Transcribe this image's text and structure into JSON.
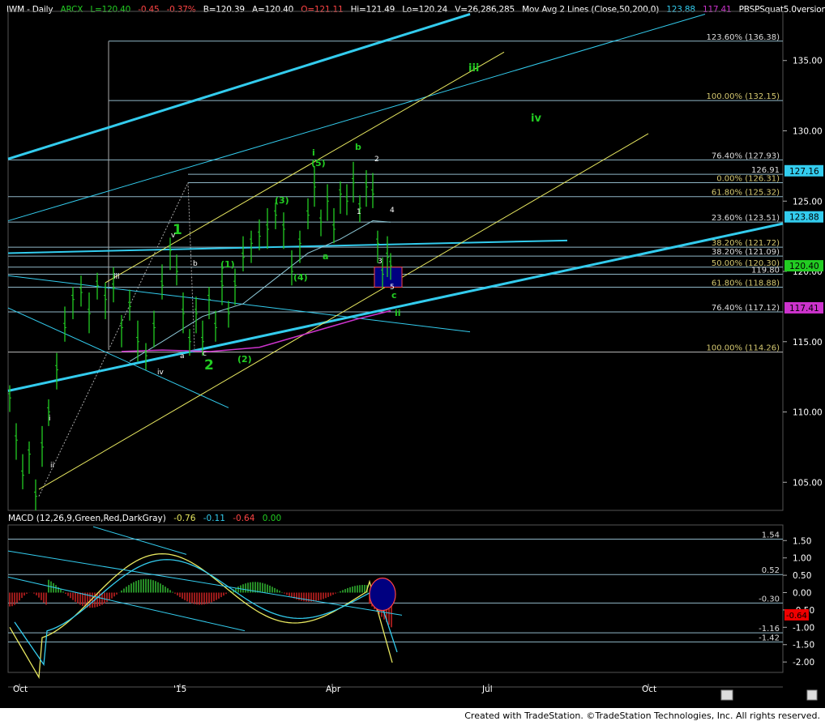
{
  "header": {
    "symbol": "IWM - Daily",
    "exchange": "ARCX",
    "last": "L=120.40",
    "chg": "-0.45",
    "pct": "-0.37%",
    "bid": "B=120.39",
    "ask": "A=120.40",
    "open": "O=121.11",
    "hi": "Hi=121.49",
    "lo": "Lo=120.24",
    "vol": "V=26,286,285",
    "ma_label": "Mov Avg 2 Lines (Close,50,200,0)",
    "ma1": "123.88",
    "ma2": "117.41",
    "indicator": "PBSPSquat5.0version (50,F..."
  },
  "macd_header": {
    "label": "MACD (12,26,9,Green,Red,DarkGray)",
    "v1": "-0.76",
    "v2": "-0.11",
    "v3": "-0.64",
    "v4": "0.00"
  },
  "footer": "Created with TradeStation. ©TradeStation Technologies, Inc. All rights reserved.",
  "colors": {
    "background": "#000000",
    "price_bars": "#22cc22",
    "channel": "#33ccee",
    "fib": "#d4c870",
    "yellow": "#e8e860",
    "magenta": "#cc33cc",
    "up_hist": "#33bb33",
    "down_hist": "#cc2222",
    "wave_label": "#22cc22"
  },
  "chart_data": [
    {
      "type": "ohlc",
      "title": "IWM - Daily",
      "x_tick_labels": [
        "Oct",
        "'15",
        "Apr",
        "Jul",
        "Oct"
      ],
      "y_tick_labels": [
        "135.00",
        "130.00",
        "125.00",
        "120.00",
        "115.00",
        "110.00",
        "105.00"
      ],
      "ylim": [
        103,
        138.5
      ],
      "price_tags": [
        {
          "value": 127.16,
          "label": "127.16",
          "color": "#33ccee"
        },
        {
          "value": 123.88,
          "label": "123.88",
          "color": "#33ccee"
        },
        {
          "value": 120.4,
          "label": "120.40",
          "color": "#22cc22"
        },
        {
          "value": 117.41,
          "label": "117.41",
          "color": "#cc33cc"
        }
      ],
      "fib_levels": [
        {
          "value": 136.38,
          "label": "123.60% (136.38)"
        },
        {
          "value": 132.15,
          "label": "100.00% (132.15)"
        },
        {
          "value": 127.93,
          "label": "76.40% (127.93)"
        },
        {
          "value": 126.91,
          "label": "126.91"
        },
        {
          "value": 126.31,
          "label": "0.00% (126.31)"
        },
        {
          "value": 125.32,
          "label": "61.80% (125.32)"
        },
        {
          "value": 123.51,
          "label": "23.60% (123.51)"
        },
        {
          "value": 121.72,
          "label": "38.20% (121.72)"
        },
        {
          "value": 121.09,
          "label": "38.20% (121.09)"
        },
        {
          "value": 120.3,
          "label": "50.00% (120.30)"
        },
        {
          "value": 119.8,
          "label": "119.80"
        },
        {
          "value": 118.88,
          "label": "61.80% (118.88)"
        },
        {
          "value": 117.12,
          "label": "76.40% (117.12)"
        },
        {
          "value": 114.26,
          "label": "100.00% (114.26)"
        }
      ],
      "wave_labels": [
        {
          "text": "1",
          "size": "big"
        },
        {
          "text": "2",
          "size": "big"
        },
        {
          "text": "iii",
          "size": "mid"
        },
        {
          "text": "iv",
          "size": "mid"
        },
        {
          "text": "i",
          "size": "small"
        },
        {
          "text": "ii",
          "size": "small"
        },
        {
          "text": "b",
          "size": "small"
        },
        {
          "text": "a",
          "size": "small"
        },
        {
          "text": "c",
          "size": "small"
        },
        {
          "text": "(1)",
          "size": "small"
        },
        {
          "text": "(2)",
          "size": "small"
        },
        {
          "text": "(3)",
          "size": "small"
        },
        {
          "text": "(4)",
          "size": "small"
        },
        {
          "text": "(5)",
          "size": "small"
        },
        {
          "text": "iii",
          "size": "tiny"
        },
        {
          "text": "iv",
          "size": "tiny"
        },
        {
          "text": "v",
          "size": "tiny"
        },
        {
          "text": "ii",
          "size": "tiny"
        },
        {
          "text": "i",
          "size": "tiny"
        },
        {
          "text": "a",
          "size": "tiny"
        },
        {
          "text": "b",
          "size": "tiny"
        },
        {
          "text": "c",
          "size": "tiny"
        },
        {
          "text": "1",
          "size": "tiny"
        },
        {
          "text": "2",
          "size": "tiny"
        },
        {
          "text": "3",
          "size": "tiny"
        },
        {
          "text": "4",
          "size": "tiny"
        },
        {
          "text": "5",
          "size": "tiny"
        }
      ]
    },
    {
      "type": "macd",
      "title": "MACD (12,26,9,Green,Red,DarkGray)",
      "y_tick_labels": [
        "1.50",
        "1.00",
        "0.50",
        "0.00",
        "-0.50",
        "-1.00",
        "-1.50",
        "-2.00"
      ],
      "ylim": [
        -2.3,
        1.95
      ],
      "levels": [
        {
          "value": 1.54,
          "label": "1.54"
        },
        {
          "value": 0.52,
          "label": "0.52"
        },
        {
          "value": -0.3,
          "label": "-0.30"
        },
        {
          "value": -1.16,
          "label": "-1.16"
        },
        {
          "value": -1.42,
          "label": "-1.42"
        }
      ],
      "current_tag": {
        "value": -0.64,
        "label": "-0.64"
      }
    }
  ]
}
